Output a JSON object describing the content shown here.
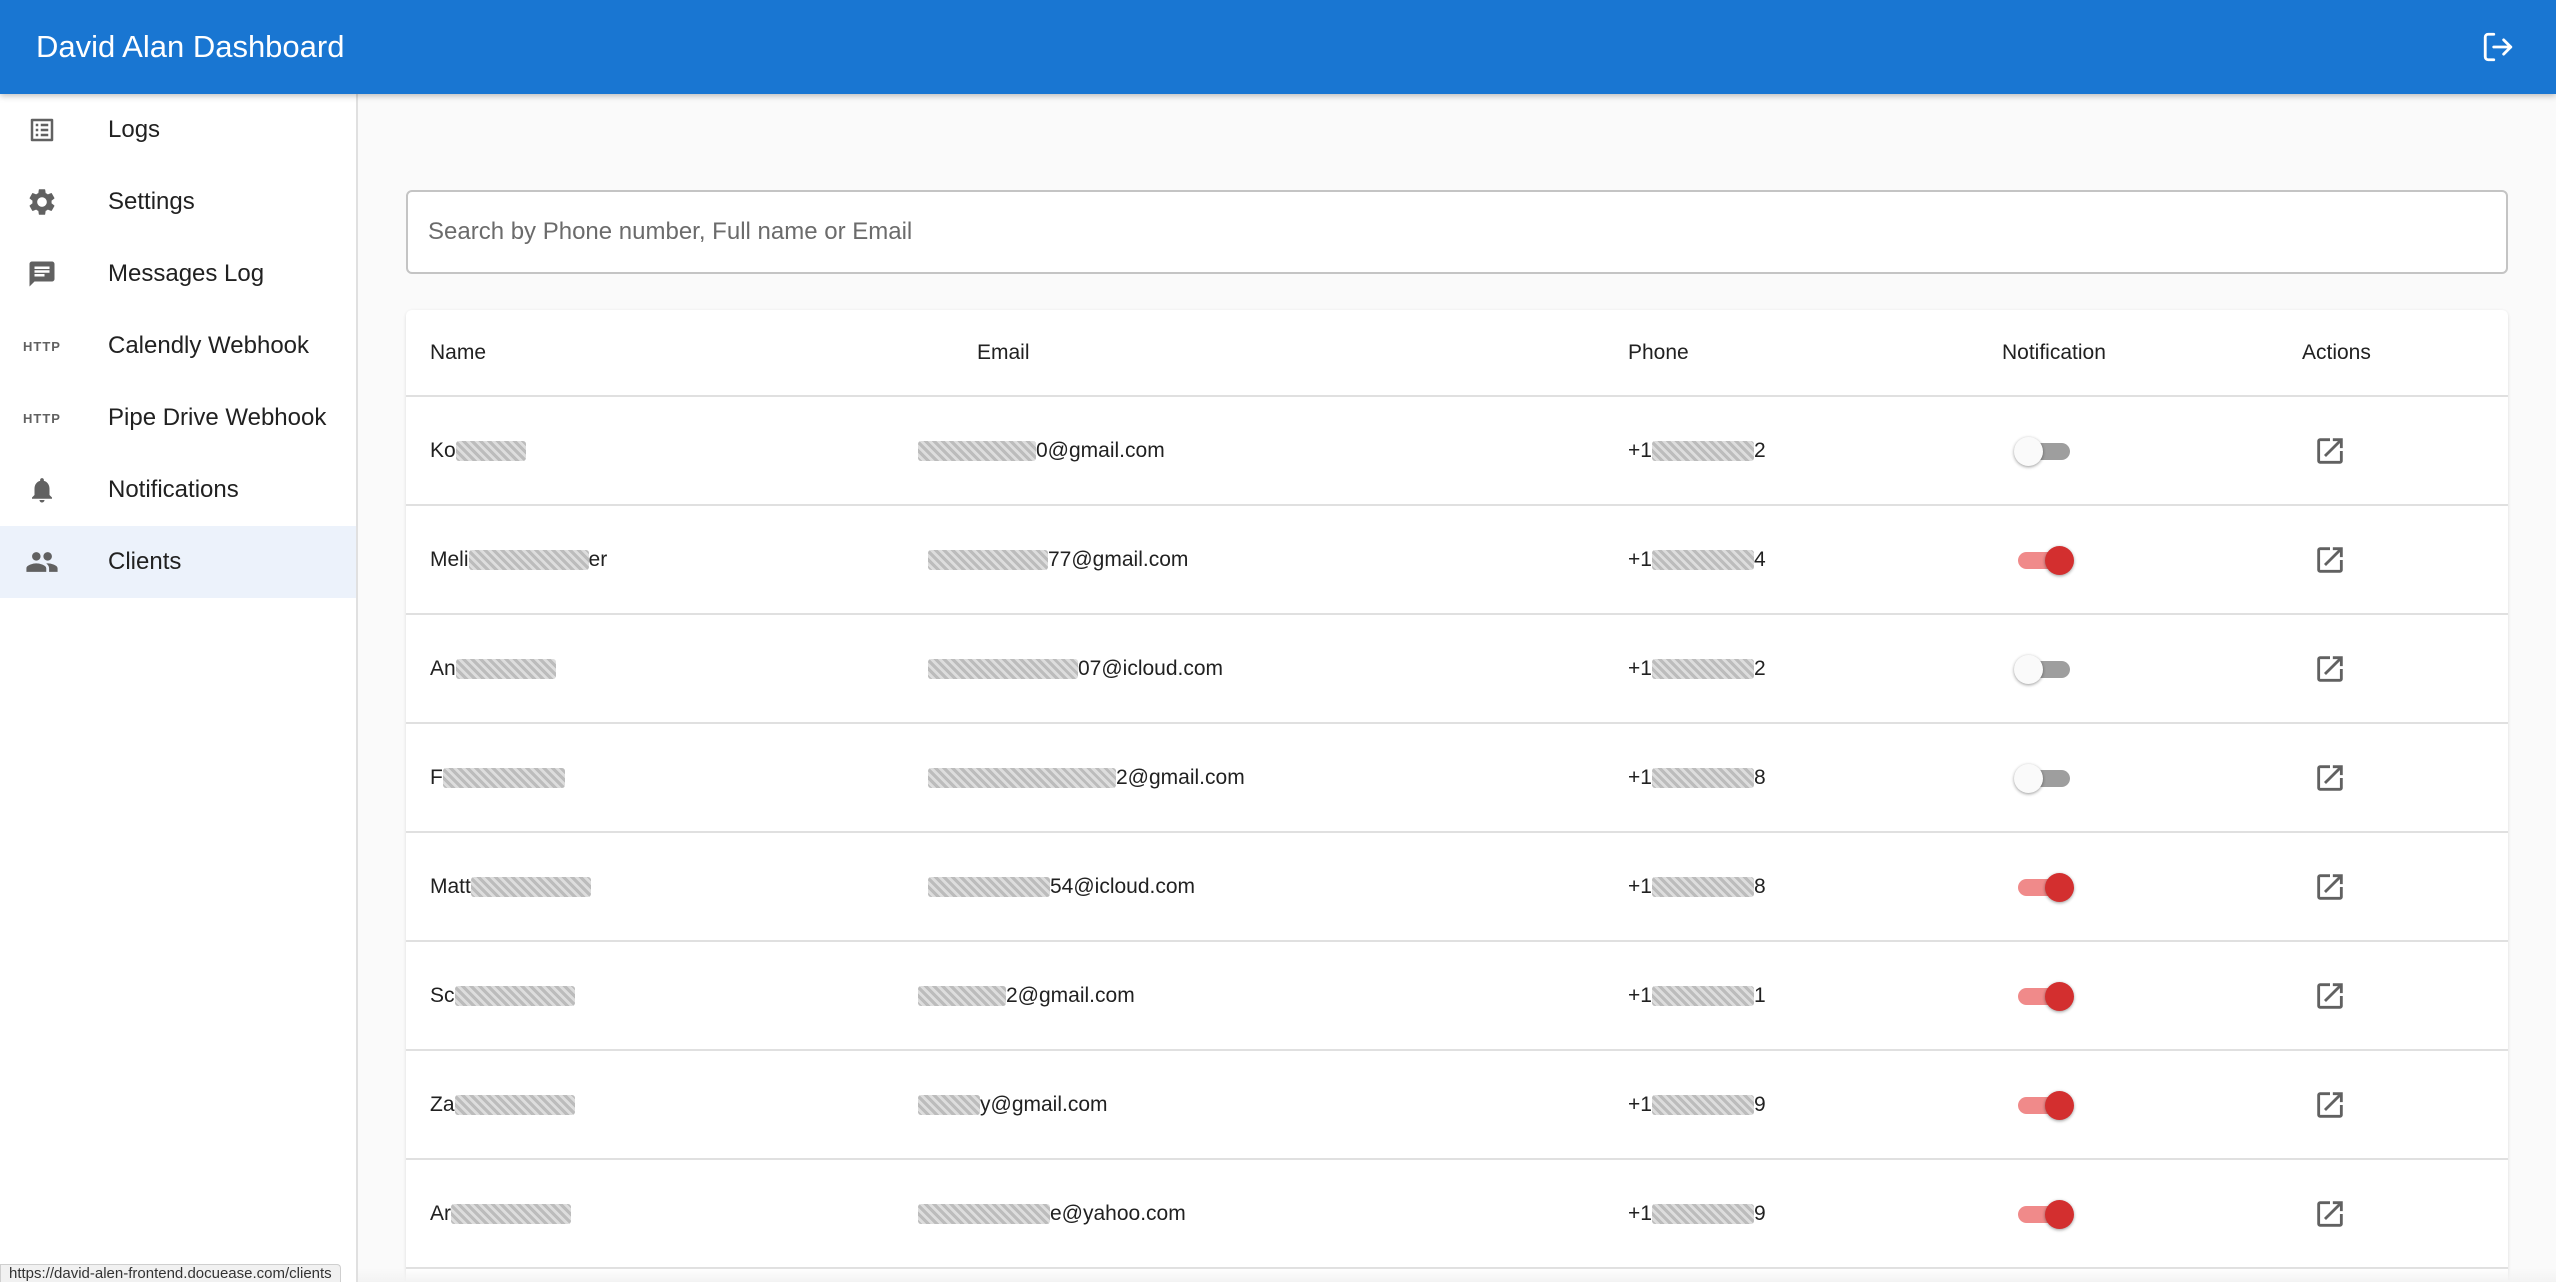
{
  "app": {
    "title": "David Alan Dashboard",
    "logout_icon": "logout-icon"
  },
  "sidebar": {
    "items": [
      {
        "label": "Logs",
        "icon": "list-icon"
      },
      {
        "label": "Settings",
        "icon": "gear-icon"
      },
      {
        "label": "Messages Log",
        "icon": "message-icon"
      },
      {
        "label": "Calendly Webhook",
        "icon": "http-icon",
        "icon_text": "HTTP"
      },
      {
        "label": "Pipe Drive Webhook",
        "icon": "http-icon",
        "icon_text": "HTTP"
      },
      {
        "label": "Notifications",
        "icon": "bell-icon"
      },
      {
        "label": "Clients",
        "icon": "people-icon",
        "active": true
      }
    ]
  },
  "search": {
    "placeholder": "Search by Phone number, Full name or Email",
    "value": ""
  },
  "table": {
    "columns": {
      "name": "Name",
      "email": "Email",
      "phone": "Phone",
      "notification": "Notification",
      "actions": "Actions"
    },
    "rows": [
      {
        "name": "Ko",
        "email": "0@gmail.com",
        "phone_prefix": "+1",
        "phone_suffix": "2",
        "notification": false
      },
      {
        "name": "Meli",
        "name_end": "er",
        "email": "77@gmail.com",
        "phone_prefix": "+1",
        "phone_suffix": "4",
        "notification": true
      },
      {
        "name": "An",
        "email": "07@icloud.com",
        "phone_prefix": "+1",
        "phone_suffix": "2",
        "notification": false
      },
      {
        "name": "F",
        "email": "2@gmail.com",
        "phone_prefix": "+1",
        "phone_suffix": "8",
        "notification": false
      },
      {
        "name": "Matt",
        "email": "54@icloud.com",
        "phone_prefix": "+1",
        "phone_suffix": "8",
        "notification": true
      },
      {
        "name": "Sc",
        "email": "2@gmail.com",
        "phone_prefix": "+1",
        "phone_suffix": "1",
        "notification": true
      },
      {
        "name": "Za",
        "email": "y@gmail.com",
        "phone_prefix": "+1",
        "phone_suffix": "9",
        "notification": true
      },
      {
        "name": "Ar",
        "email": "e@yahoo.com",
        "phone_prefix": "+1",
        "phone_suffix": "9",
        "notification": true
      }
    ]
  },
  "status_bar": {
    "url": "https://david-alen-frontend.docuease.com/clients"
  },
  "colors": {
    "appbar": "#1976d2",
    "toggle_on": "#d32f2f",
    "toggle_track_on": "#f08a8a",
    "toggle_off_track": "#9e9e9e",
    "active_nav": "#ecf2fb"
  }
}
